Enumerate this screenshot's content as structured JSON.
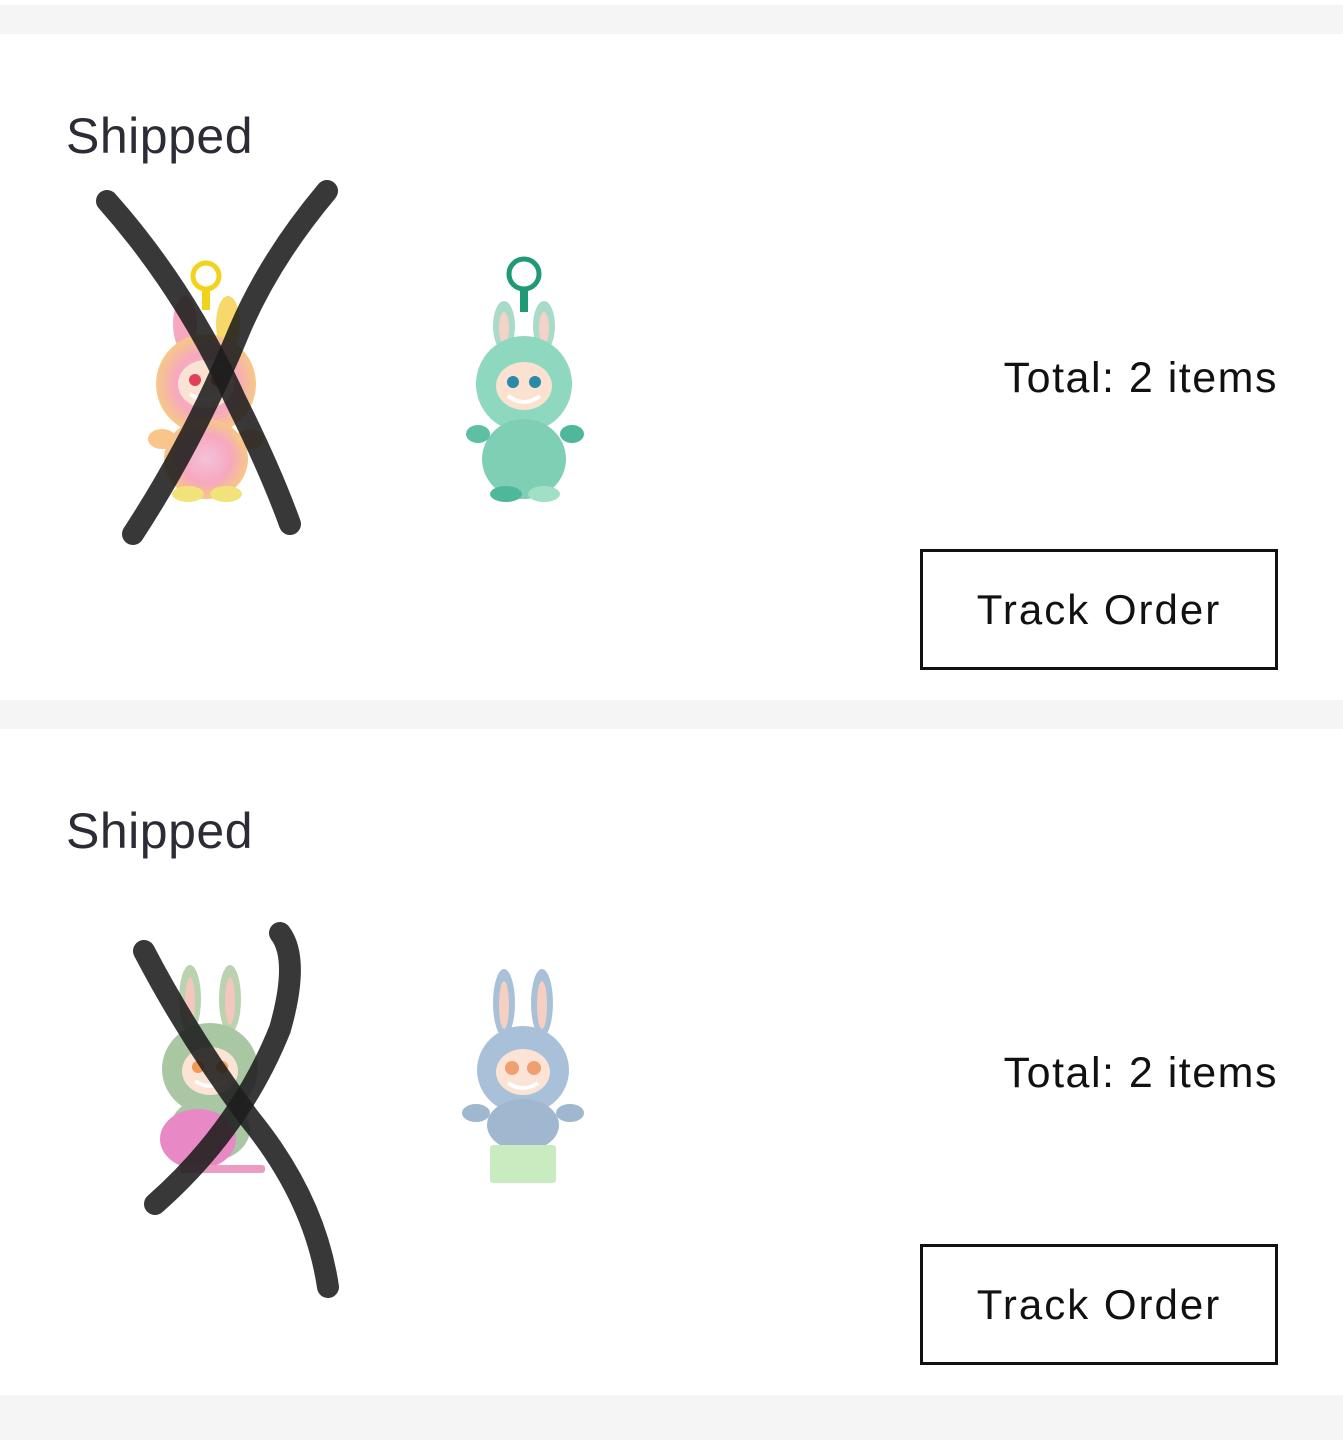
{
  "orders": [
    {
      "status": "Shipped",
      "total": "Total: 2 items",
      "track_label": "Track Order",
      "items": [
        {
          "icon": "pink-rainbow-bunny-keychain-icon",
          "crossed_out": true,
          "colors": {
            "body": "#f6a8bf",
            "accent": "#f7d86b",
            "loop": "#f2d21b"
          }
        },
        {
          "icon": "green-bunny-keychain-icon",
          "crossed_out": false,
          "colors": {
            "body": "#8fd8c0",
            "accent": "#4fb89a",
            "loop": "#1f9a74"
          }
        }
      ]
    },
    {
      "status": "Shipped",
      "total": "Total: 2 items",
      "track_label": "Track Order",
      "items": [
        {
          "icon": "green-bunny-figure-icon",
          "crossed_out": true,
          "colors": {
            "body": "#a9c7a3",
            "accent": "#f3b7b0",
            "base": "#e889c6"
          }
        },
        {
          "icon": "blue-bunny-figure-icon",
          "crossed_out": false,
          "colors": {
            "body": "#a9c1d8",
            "accent": "#f0a070",
            "base": "#c8ecc0"
          }
        }
      ]
    }
  ]
}
